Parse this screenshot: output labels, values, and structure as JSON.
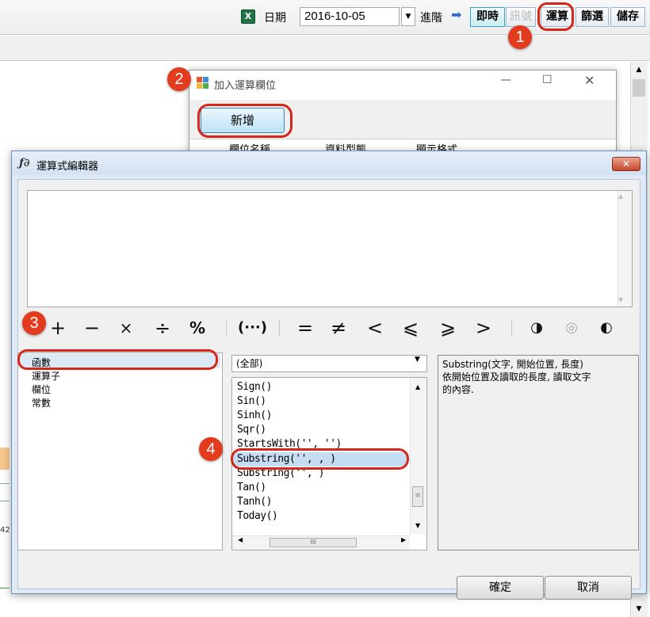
{
  "toolbar": {
    "excel_icon": "excel-icon",
    "date_label": "日期",
    "date_value": "2016-10-05",
    "advanced_label": "進階",
    "advanced_arrow": "➡",
    "buttons": {
      "realtime": "即時",
      "signal": "訊號",
      "calc": "運算",
      "filter": "篩選",
      "save": "儲存"
    }
  },
  "background": {
    "chart_fragment_label": "42"
  },
  "add_dialog": {
    "title": "加入運算欄位",
    "min_glyph": "—",
    "max_glyph": "☐",
    "close_glyph": "✕",
    "new_button": "新增",
    "columns": [
      "欄位名稱",
      "資料型態",
      "顯示格式"
    ]
  },
  "editor": {
    "title_icon": "ƒ∂",
    "title": "運算式編輯器",
    "close_glyph": "✕",
    "expression": "",
    "operators": {
      "plus": "+",
      "minus": "−",
      "times": "×",
      "divide": "÷",
      "percent": "%",
      "paren": "(···)",
      "equal": "=",
      "not_equal": "≠",
      "less": "<",
      "less_equal": "⩽",
      "greater_equal": "⩾",
      "greater": ">",
      "and": "◑",
      "or": "◎",
      "not": "◐"
    },
    "categories": [
      "函數",
      "運算子",
      "欄位",
      "常數"
    ],
    "function_filter": "(全部)",
    "functions": [
      "Sign()",
      "Sin()",
      "Sinh()",
      "Sqr()",
      "StartsWith('', '')",
      "Substring('', , )",
      "Substring('', )",
      "Tan()",
      "Tanh()",
      "Today()"
    ],
    "hscroll_thumb": "III",
    "description": [
      "Substring(文字, 開始位置, 長度)",
      "依開始位置及讀取的長度, 讀取文字",
      "的內容."
    ],
    "ok_button": "確定",
    "cancel_button": "取消"
  },
  "annotations": {
    "step1": "1",
    "step2": "2",
    "step3": "3",
    "step4": "4",
    "accent_color": "#e23b1e"
  }
}
